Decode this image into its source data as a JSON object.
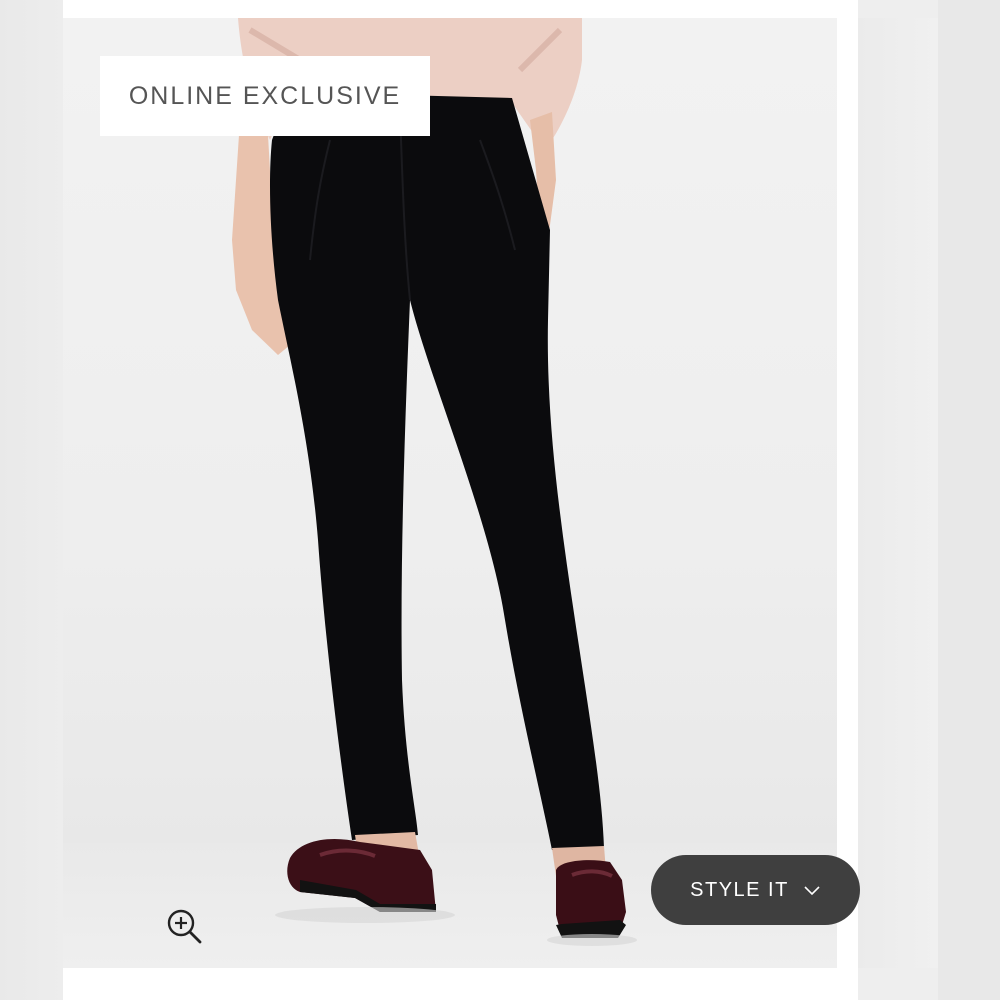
{
  "product_card": {
    "badge_label": "ONLINE EXCLUSIVE",
    "zoom_icon": "zoom-in-icon",
    "style_button": {
      "label": "STYLE IT",
      "icon": "chevron-down-icon"
    }
  },
  "colors": {
    "button_background": "#3f3f3f",
    "button_text": "#ffffff",
    "badge_background": "#ffffff",
    "badge_text": "#555555",
    "page_background": "#eeeeee"
  }
}
